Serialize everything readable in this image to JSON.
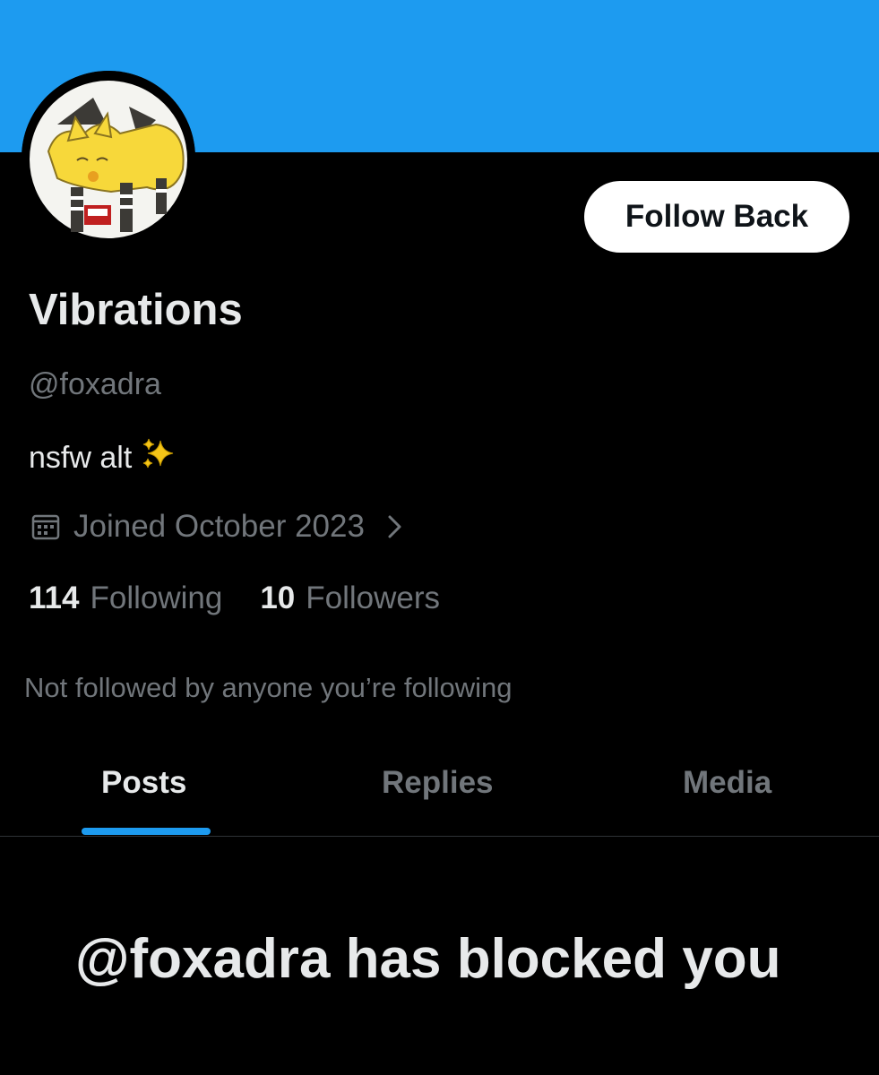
{
  "profile": {
    "display_name": "Vibrations",
    "handle": "@foxadra",
    "bio": "nsfw alt",
    "bio_emoji": "sparkles-icon",
    "joined": "Joined October 2023",
    "following_count": "114",
    "following_label": "Following",
    "followers_count": "10",
    "followers_label": "Followers",
    "mutuals_note": "Not followed by anyone you’re following"
  },
  "actions": {
    "follow_label": "Follow Back"
  },
  "tabs": [
    {
      "label": "Posts",
      "active": true
    },
    {
      "label": "Replies",
      "active": false
    },
    {
      "label": "Media",
      "active": false
    }
  ],
  "blocked_message": "@foxadra has blocked you",
  "colors": {
    "banner": "#1d9bf0",
    "background": "#000000",
    "primary_text": "#e7e9ea",
    "secondary_text": "#71767b",
    "accent": "#1d9bf0",
    "button_bg": "#ffffff",
    "button_text": "#0f1419"
  }
}
